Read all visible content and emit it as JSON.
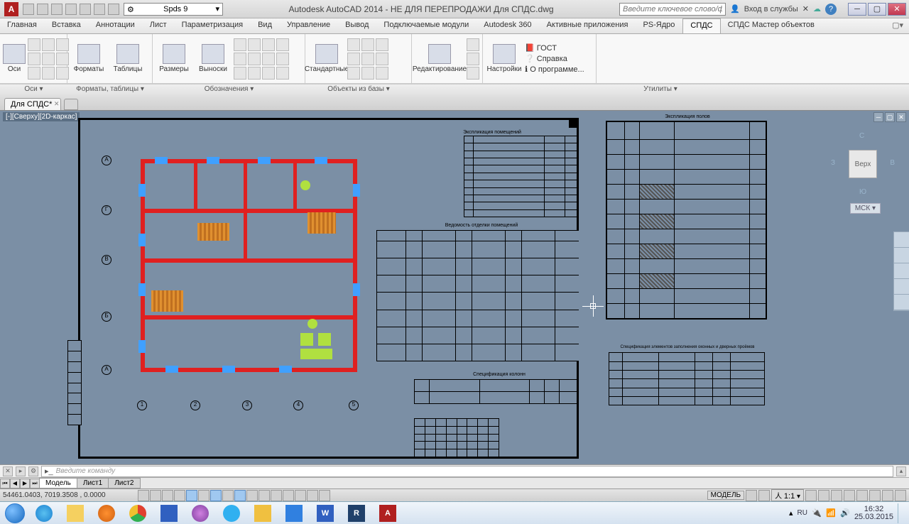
{
  "titlebar": {
    "workspace": "Spds 9",
    "title": "Autodesk AutoCAD 2014 - НЕ ДЛЯ ПЕРЕПРОДАЖИ   Для СПДС.dwg",
    "search_placeholder": "Введите ключевое слово/фразу",
    "signin": "Вход в службы"
  },
  "menus": [
    "Главная",
    "Вставка",
    "Аннотации",
    "Лист",
    "Параметризация",
    "Вид",
    "Управление",
    "Вывод",
    "Подключаемые модули",
    "Autodesk 360",
    "Активные приложения",
    "PS-Ядро",
    "СПДС",
    "СПДС Мастер объектов"
  ],
  "active_menu": 12,
  "ribbon": {
    "axes": "Оси",
    "formats": "Форматы",
    "tables": "Таблицы",
    "sizes": "Размеры",
    "callouts": "Выноски",
    "standard": "Стандартные",
    "edit": "Редактирование",
    "settings": "Настройки",
    "gost": "ГОСТ",
    "help": "Справка",
    "about": "О программе...",
    "panel_axes": "Оси ▾",
    "panel_formats": "Форматы, таблицы ▾",
    "panel_notes": "Обозначения ▾",
    "panel_objects": "Объекты из базы ▾",
    "panel_utils": "Утилиты ▾"
  },
  "filetab": "Для СПДС*",
  "view_title": "[-][Сверху][2D-каркас]",
  "viewcube": {
    "top": "Верх",
    "n": "С",
    "s": "Ю",
    "e": "В",
    "w": "З"
  },
  "wcs": "МСК ▾",
  "drawing_titles": {
    "t1": "Экспликация помещений",
    "t2": "Ведомость отделки помещений",
    "t3": "Спецификация колонн",
    "t4": "Экспликация полов",
    "t5": "Спецификация элементов заполнения оконных и дверных проёмов"
  },
  "cmd": {
    "placeholder": "Введите команду"
  },
  "model_tabs": [
    "Модель",
    "Лист1",
    "Лист2"
  ],
  "status": {
    "coords": "54461.0403, 7019.3508 , 0.0000",
    "model": "МОДЕЛЬ",
    "scale": "1:1"
  },
  "tray": {
    "lang": "RU",
    "time": "16:32",
    "date": "25.03.2015"
  }
}
